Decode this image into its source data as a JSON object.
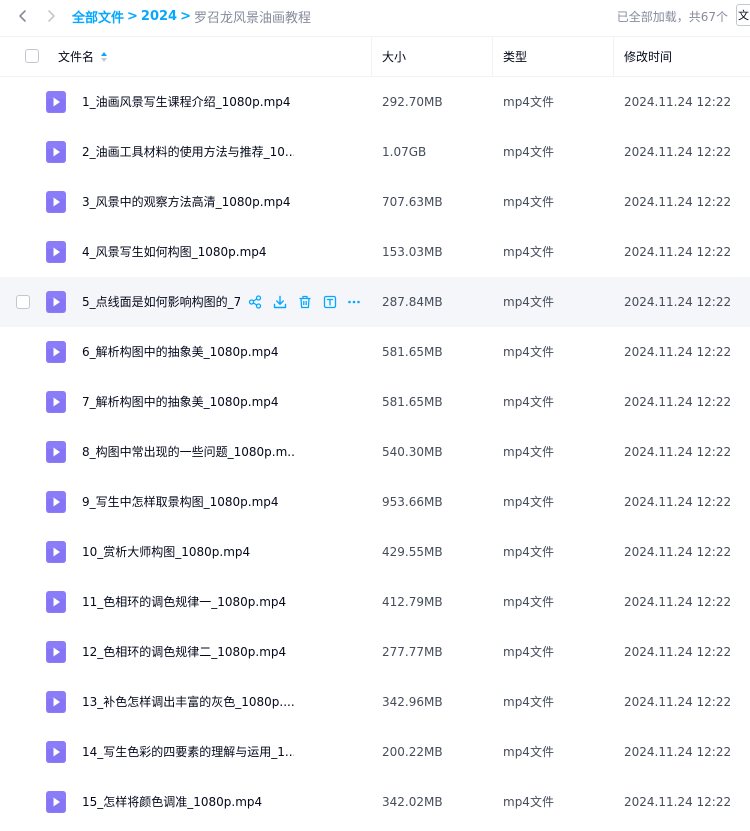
{
  "breadcrumb": {
    "root": "全部文件",
    "separator": ">",
    "folder": "2024",
    "current": "罗召龙风景油画教程"
  },
  "status": {
    "loaded": "已全部加载，共67个",
    "edge_label": "文"
  },
  "columns": {
    "name": "文件名",
    "size": "大小",
    "type": "类型",
    "modified": "修改时间"
  },
  "colors": {
    "accent": "#06a7ff",
    "video_icon": "#8b7cf7",
    "hover_row": "#f5f6f9"
  },
  "row_actions": [
    "share-icon",
    "download-icon",
    "delete-icon",
    "text-icon",
    "more-icon"
  ],
  "files": [
    {
      "name": "1_油画风景写生课程介绍_1080p.mp4",
      "size": "292.70MB",
      "type": "mp4文件",
      "modified": "2024.11.24 12:22"
    },
    {
      "name": "2_油画工具材料的使用方法与推荐_10...",
      "size": "1.07GB",
      "type": "mp4文件",
      "modified": "2024.11.24 12:22"
    },
    {
      "name": "3_风景中的观察方法高清_1080p.mp4",
      "size": "707.63MB",
      "type": "mp4文件",
      "modified": "2024.11.24 12:22"
    },
    {
      "name": "4_风景写生如何构图_1080p.mp4",
      "size": "153.03MB",
      "type": "mp4文件",
      "modified": "2024.11.24 12:22"
    },
    {
      "name": "5_点线面是如何影响构图的_72",
      "size": "287.84MB",
      "type": "mp4文件",
      "modified": "2024.11.24 12:22",
      "hovered": true
    },
    {
      "name": "6_解析构图中的抽象美_1080p.mp4",
      "size": "581.65MB",
      "type": "mp4文件",
      "modified": "2024.11.24 12:22"
    },
    {
      "name": "7_解析构图中的抽象美_1080p.mp4",
      "size": "581.65MB",
      "type": "mp4文件",
      "modified": "2024.11.24 12:22"
    },
    {
      "name": "8_构图中常出现的一些问题_1080p.m...",
      "size": "540.30MB",
      "type": "mp4文件",
      "modified": "2024.11.24 12:22"
    },
    {
      "name": "9_写生中怎样取景构图_1080p.mp4",
      "size": "953.66MB",
      "type": "mp4文件",
      "modified": "2024.11.24 12:22"
    },
    {
      "name": "10_赏析大师构图_1080p.mp4",
      "size": "429.55MB",
      "type": "mp4文件",
      "modified": "2024.11.24 12:22"
    },
    {
      "name": "11_色相环的调色规律一_1080p.mp4",
      "size": "412.79MB",
      "type": "mp4文件",
      "modified": "2024.11.24 12:22"
    },
    {
      "name": "12_色相环的调色规律二_1080p.mp4",
      "size": "277.77MB",
      "type": "mp4文件",
      "modified": "2024.11.24 12:22"
    },
    {
      "name": "13_补色怎样调出丰富的灰色_1080p....",
      "size": "342.96MB",
      "type": "mp4文件",
      "modified": "2024.11.24 12:22"
    },
    {
      "name": "14_写生色彩的四要素的理解与运用_1...",
      "size": "200.22MB",
      "type": "mp4文件",
      "modified": "2024.11.24 12:22"
    },
    {
      "name": "15_怎样将颜色调准_1080p.mp4",
      "size": "342.02MB",
      "type": "mp4文件",
      "modified": "2024.11.24 12:22"
    }
  ]
}
